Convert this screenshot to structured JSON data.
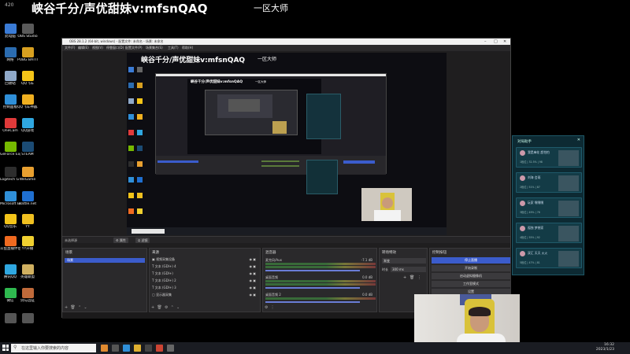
{
  "overlay": {
    "title": "峡谷千分/声优甜妹v:mfsnQAQ",
    "subtitle": "一区大师",
    "top_left": "420"
  },
  "desktop_icons": [
    {
      "label": "此电脑",
      "color": "#3a7bd5"
    },
    {
      "label": "OBS Studio",
      "color": "#5a5a5a"
    },
    {
      "label": "网络",
      "color": "#2b6cb0"
    },
    {
      "label": "PUBG BATTLEGR...",
      "color": "#d8a020"
    },
    {
      "label": "回收站",
      "color": "#8fa9c9"
    },
    {
      "label": "QQ飞车",
      "color": "#f5c518"
    },
    {
      "label": "控制面板",
      "color": "#2f8fd8"
    },
    {
      "label": "QQ飞车神器工具",
      "color": "#f0b020"
    },
    {
      "label": "OneCam",
      "color": "#e03a3a"
    },
    {
      "label": "QQ游戏",
      "color": "#2fa7e0"
    },
    {
      "label": "GeForce Experience",
      "color": "#76b900"
    },
    {
      "label": "STEAM",
      "color": "#1b4b74"
    },
    {
      "label": "Logitech G HUB",
      "color": "#2d2d2d"
    },
    {
      "label": "WeGame",
      "color": "#e8a030"
    },
    {
      "label": "Microsoft Edge",
      "color": "#2f8fd8"
    },
    {
      "label": "Battle.net",
      "color": "#1f6fd0"
    },
    {
      "label": "QQ音乐",
      "color": "#f3c419"
    },
    {
      "label": "YY",
      "color": "#f0c020"
    },
    {
      "label": "斗鱼直播伴侣",
      "color": "#f06a20"
    },
    {
      "label": "YY开播",
      "color": "#f0d030"
    },
    {
      "label": "腾讯QQ",
      "color": "#2fa7e0"
    },
    {
      "label": "英雄联盟",
      "color": "#d0b060"
    },
    {
      "label": "微信",
      "color": "#2fb94f"
    },
    {
      "label": "剑与远征",
      "color": "#c06a3a"
    },
    {
      "label": "",
      "color": "#555"
    },
    {
      "label": "",
      "color": "#555"
    }
  ],
  "obs": {
    "title": "OBS 28.1.2 (64-bit, windows) - 配置文件: 未命名 - 场景: 未命名",
    "menu": [
      "文件(F)",
      "编辑(E)",
      "视图(V)",
      "停靠窗口(D)",
      "配置文件(P)",
      "场景集合(S)",
      "工具(T)",
      "帮助(H)"
    ],
    "preview_title": "峡谷千分/声优甜妹v:mfsnQAQ",
    "preview_sub": "一区大师",
    "nested_title": "峡谷千分/声优甜妹v:mfsnQAQ",
    "nested_sub": "一区大师",
    "no_source": "未选择源",
    "props_btn": "属性",
    "filters_btn": "滤镜",
    "scenes": {
      "title": "场景",
      "items": [
        "场景"
      ]
    },
    "sources": {
      "title": "来源",
      "items": [
        "视频采集设备",
        "文本 (GDI+) 4",
        "文本 (GDI+)",
        "文本 (GDI+) 2",
        "文本 (GDI+) 3",
        "显示器采集"
      ]
    },
    "mixer": {
      "title": "混音器",
      "channels": [
        {
          "name": "麦克风/Aux",
          "value": "-7.1 dB"
        },
        {
          "name": "桌面音频",
          "value": "0.0 dB"
        },
        {
          "name": "桌面音频 2",
          "value": "0.0 dB"
        }
      ]
    },
    "transitions": {
      "title": "转场特效",
      "type": "渐变",
      "duration_label": "时长",
      "duration": "300 ms"
    },
    "controls": {
      "title": "控制按钮",
      "items": [
        "停止直播",
        "开始录制",
        "启动虚拟摄像机",
        "工作室模式",
        "设置",
        "退出"
      ]
    },
    "status": "LIVE: 00:00:00   REC: 00:00:00   CPU: 3.6%, 60.00 fps"
  },
  "assistant": {
    "title": "对局助手",
    "cards": [
      {
        "name": "我是麻花 超怕怕",
        "detail": "1段位 | 32.5% | 98"
      },
      {
        "name": "刘海 会雨",
        "detail": "2段位 | 51% | 87"
      },
      {
        "name": "玩家 嘿嘿嘿",
        "detail": "3段位 | 49% | 76"
      },
      {
        "name": "孤独 梦想家",
        "detail": "4段位 | 55% | 92"
      },
      {
        "name": "双汇 天天 火火",
        "detail": "5段位 | 47% | 81"
      }
    ]
  },
  "taskbar": {
    "search_placeholder": "在这里输入你要搜索的内容",
    "time": "16:32",
    "date": "2023/1/23"
  }
}
